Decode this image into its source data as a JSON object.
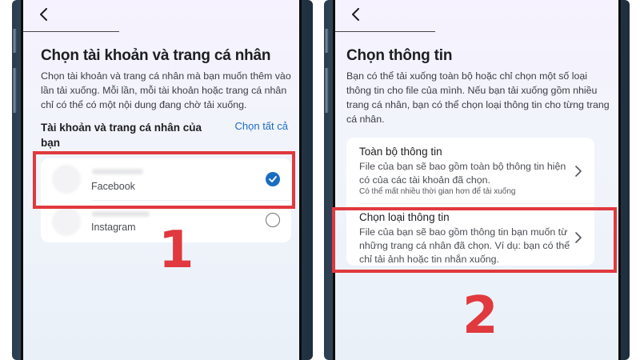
{
  "left_screen": {
    "title": "Chọn tài khoản và trang cá nhân",
    "description": "Chọn tài khoản và trang cá nhân mà bạn muốn thêm vào lần tải xuống. Mỗi lần, mỗi tài khoản hoặc trang cá nhân chỉ có thể có một nội dung đang chờ tải xuống.",
    "section_heading": "Tài khoản và trang cá nhân của bạn",
    "select_all_label": "Chọn tất cả",
    "accounts": [
      {
        "platform": "Facebook",
        "selected": true
      },
      {
        "platform": "Instagram",
        "selected": false
      }
    ],
    "step_number": "1"
  },
  "right_screen": {
    "title": "Chọn thông tin",
    "description": "Bạn có thể tải xuống toàn bộ hoặc chỉ chọn một số loại thông tin cho file của mình. Nếu bạn tải xuống gồm nhiều trang cá nhân, bạn có thể chọn loại thông tin cho từng trang cá nhân.",
    "options": [
      {
        "title": "Toàn bộ thông tin",
        "description": "File của bạn sẽ bao gồm toàn bộ thông tin hiện có của các tài khoản đã chọn.",
        "note": "Có thể mất nhiều thời gian hơn để tải xuống"
      },
      {
        "title": "Chọn loại thông tin",
        "description": "File của bạn sẽ bao gồm thông tin bạn muốn từ những trang cá nhân đã chọn. Ví dụ: bạn có thể chỉ tải ảnh hoặc tin nhắn xuống."
      }
    ],
    "step_number": "2"
  },
  "colors": {
    "accent_blue": "#1a6cc2",
    "highlight_red": "#e0393e"
  },
  "icons": [
    "back-arrow-icon",
    "checkmark-icon",
    "chevron-right-icon"
  ]
}
